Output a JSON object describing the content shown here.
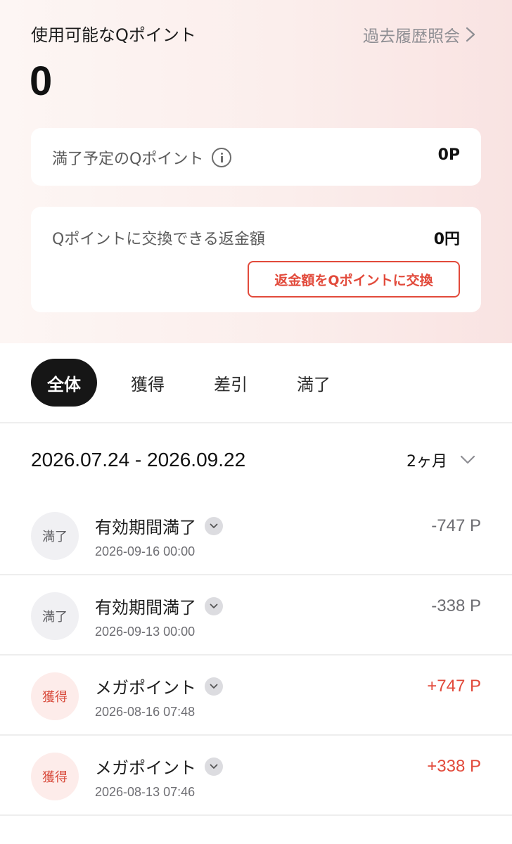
{
  "header": {
    "available_label": "使用可能なQポイント",
    "history_link": "過去履歴照会",
    "balance": "0"
  },
  "expiring_card": {
    "label": "満了予定のQポイント",
    "value": "0P"
  },
  "refund_card": {
    "label": "Qポイントに交換できる返金額",
    "value": "0円",
    "button": "返金額をQポイントに交換"
  },
  "tabs": [
    {
      "label": "全体",
      "active": true
    },
    {
      "label": "獲得",
      "active": false
    },
    {
      "label": "差引",
      "active": false
    },
    {
      "label": "満了",
      "active": false
    }
  ],
  "filter": {
    "date_range": "2026.07.24 - 2026.09.22",
    "period": "2ヶ月"
  },
  "transactions": [
    {
      "badge": "満了",
      "type": "expire",
      "title": "有効期間満了",
      "datetime": "2026-09-16 00:00",
      "amount": "-747 P"
    },
    {
      "badge": "満了",
      "type": "expire",
      "title": "有効期間満了",
      "datetime": "2026-09-13 00:00",
      "amount": "-338 P"
    },
    {
      "badge": "獲得",
      "type": "earn",
      "title": "メガポイント",
      "datetime": "2026-08-16 07:48",
      "amount": "+747 P"
    },
    {
      "badge": "獲得",
      "type": "earn",
      "title": "メガポイント",
      "datetime": "2026-08-13 07:46",
      "amount": "+338 P"
    }
  ],
  "colors": {
    "accent": "#e24a3b",
    "tab_active_bg": "#161616",
    "expire_badge_bg": "#f0f0f3",
    "earn_badge_bg": "#fdecea"
  },
  "icons": {
    "history_chevron": "chevron-right-icon",
    "info": "info-icon",
    "period_chevron": "chevron-down-icon",
    "row_expand": "chevron-down-circle-icon"
  }
}
